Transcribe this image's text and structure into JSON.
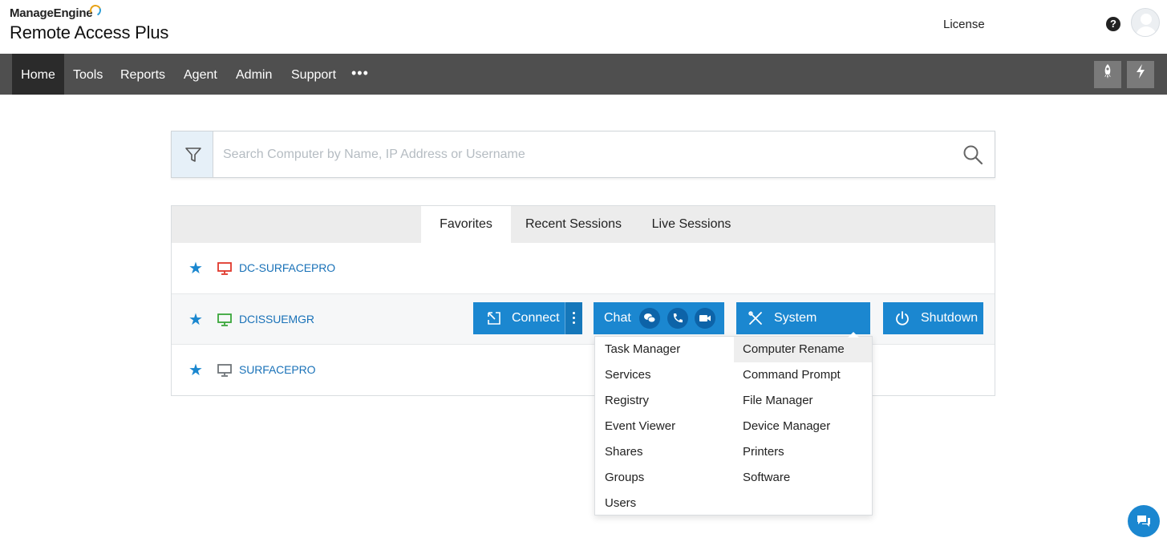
{
  "header": {
    "brand_top": "ManageEngine",
    "brand_main": "Remote Access Plus",
    "license_label": "License",
    "help_glyph": "?",
    "help_icon": "question-circle-icon",
    "avatar_icon": "user-avatar-icon"
  },
  "nav": {
    "items": [
      {
        "label": "Home",
        "active": true
      },
      {
        "label": "Tools",
        "active": false
      },
      {
        "label": "Reports",
        "active": false
      },
      {
        "label": "Agent",
        "active": false
      },
      {
        "label": "Admin",
        "active": false
      },
      {
        "label": "Support",
        "active": false
      }
    ],
    "more_label": "•••",
    "right_buttons": [
      {
        "icon": "rocket-icon"
      },
      {
        "icon": "lightning-icon"
      }
    ]
  },
  "search": {
    "placeholder": "Search Computer by Name, IP Address or Username",
    "value": "",
    "filter_icon": "filter-icon",
    "search_icon": "search-icon"
  },
  "tabs": [
    {
      "label": "Favorites",
      "active": true
    },
    {
      "label": "Recent Sessions",
      "active": false
    },
    {
      "label": "Live Sessions",
      "active": false
    }
  ],
  "computers": [
    {
      "name": "DC-SURFACEPRO",
      "status_color": "#e0372b",
      "favorite": true
    },
    {
      "name": "DCISSUEMGR",
      "status_color": "#3aa63a",
      "favorite": true
    },
    {
      "name": "SURFACEPRO",
      "status_color": "#6f7478",
      "favorite": true
    }
  ],
  "actions": {
    "connect": "Connect",
    "chat": "Chat",
    "chat_icons": [
      "chat-bubble-icon",
      "phone-icon",
      "video-icon"
    ],
    "system_manager": "System Manager",
    "shutdown": "Shutdown"
  },
  "dropdown": {
    "left": [
      "Task Manager",
      "Services",
      "Registry",
      "Event Viewer",
      "Shares",
      "Groups",
      "Users"
    ],
    "right": [
      "Computer Rename",
      "Command Prompt",
      "File Manager",
      "Device Manager",
      "Printers",
      "Software"
    ],
    "highlighted": "Computer Rename"
  },
  "colors": {
    "accent": "#1b87d0",
    "nav_bg": "#4f4f4f",
    "nav_active": "#2b2b2b",
    "link": "#1a72b8"
  }
}
